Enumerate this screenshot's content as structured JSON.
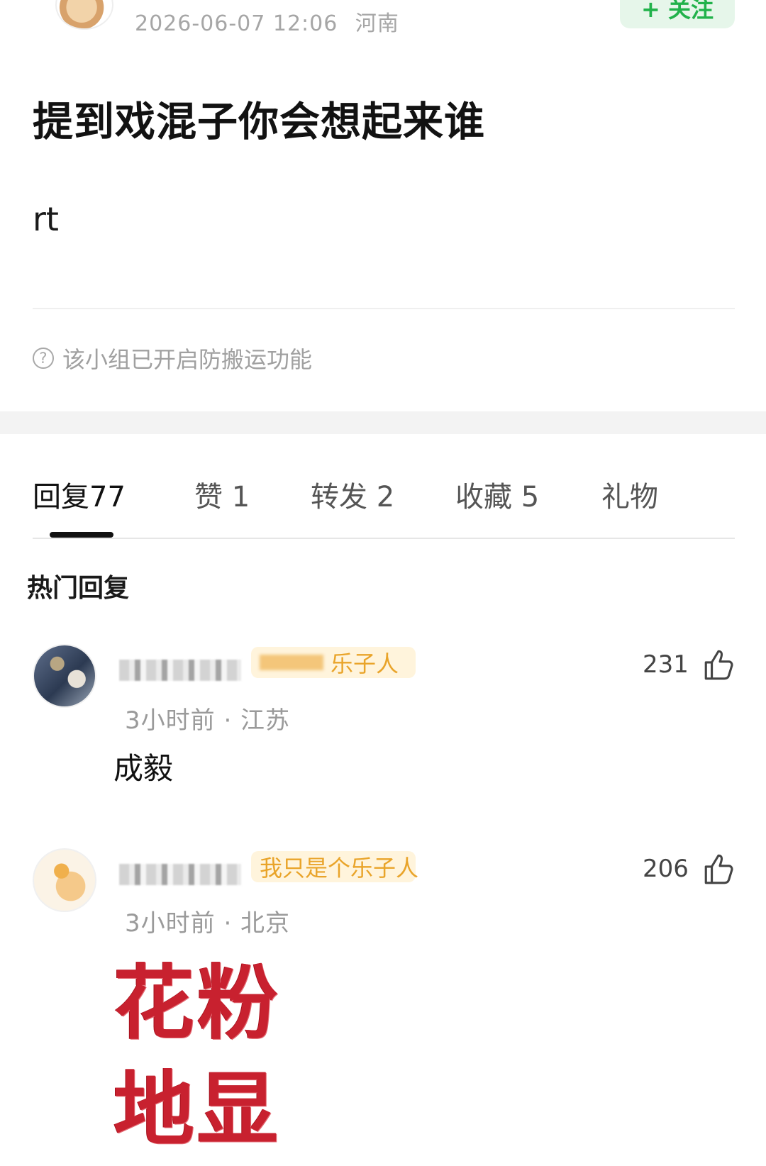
{
  "post": {
    "timestamp": "2026-06-07 12:06",
    "location": "河南",
    "follow_label": "+ 关注",
    "title": "提到戏混子你会想起来谁",
    "body": "rt",
    "notice": "该小组已开启防搬运功能",
    "help_icon": "question-circle-icon"
  },
  "tabs": [
    {
      "label": "回复",
      "count": "77"
    },
    {
      "label": "赞",
      "count": "1"
    },
    {
      "label": "转发",
      "count": "2"
    },
    {
      "label": "收藏",
      "count": "5"
    },
    {
      "label": "礼物",
      "count": ""
    }
  ],
  "hot_heading": "热门回复",
  "comments": [
    {
      "badge": "乐子人",
      "time_location": "3小时前 · 江苏",
      "text": "成毅",
      "likes": "231",
      "like_icon": "thumbs-up-icon"
    },
    {
      "badge": "我只是个乐子人",
      "time_location": "3小时前 · 北京",
      "sticker_lines": [
        "花粉",
        "地显"
      ],
      "likes": "206",
      "like_icon": "thumbs-up-icon"
    }
  ],
  "colors": {
    "accent_green": "#21b24b",
    "badge_orange": "#e9a42a",
    "sticker_red": "#c8212f"
  }
}
